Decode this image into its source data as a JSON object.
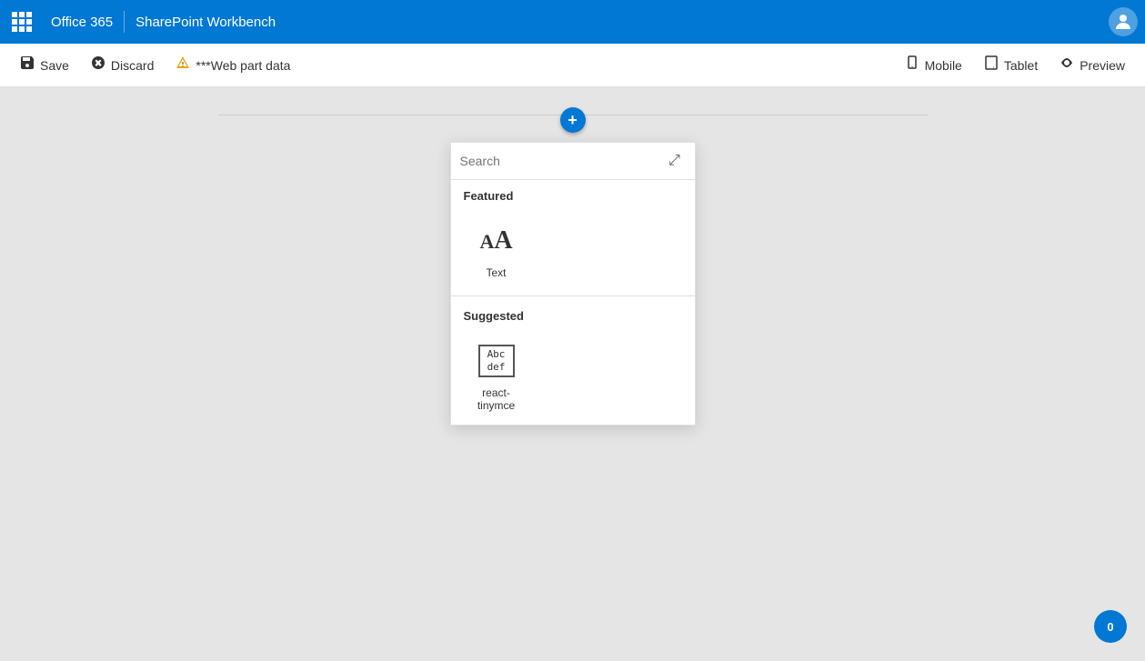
{
  "topbar": {
    "app_name": "Office 365",
    "divider": "|",
    "page_title": "SharePoint Workbench"
  },
  "toolbar": {
    "save_label": "Save",
    "discard_label": "Discard",
    "webpart_label": "***Web part data",
    "mobile_label": "Mobile",
    "tablet_label": "Tablet",
    "preview_label": "Preview"
  },
  "picker": {
    "search_placeholder": "Search",
    "expand_icon": "⤢",
    "featured_label": "Featured",
    "suggested_label": "Suggested",
    "featured_items": [
      {
        "id": "text",
        "label": "Text",
        "icon_type": "text"
      }
    ],
    "suggested_items": [
      {
        "id": "react-tinymce",
        "label": "react-tinymce",
        "icon_type": "abcdef"
      }
    ]
  },
  "bottom_badge": {
    "label": "0"
  }
}
